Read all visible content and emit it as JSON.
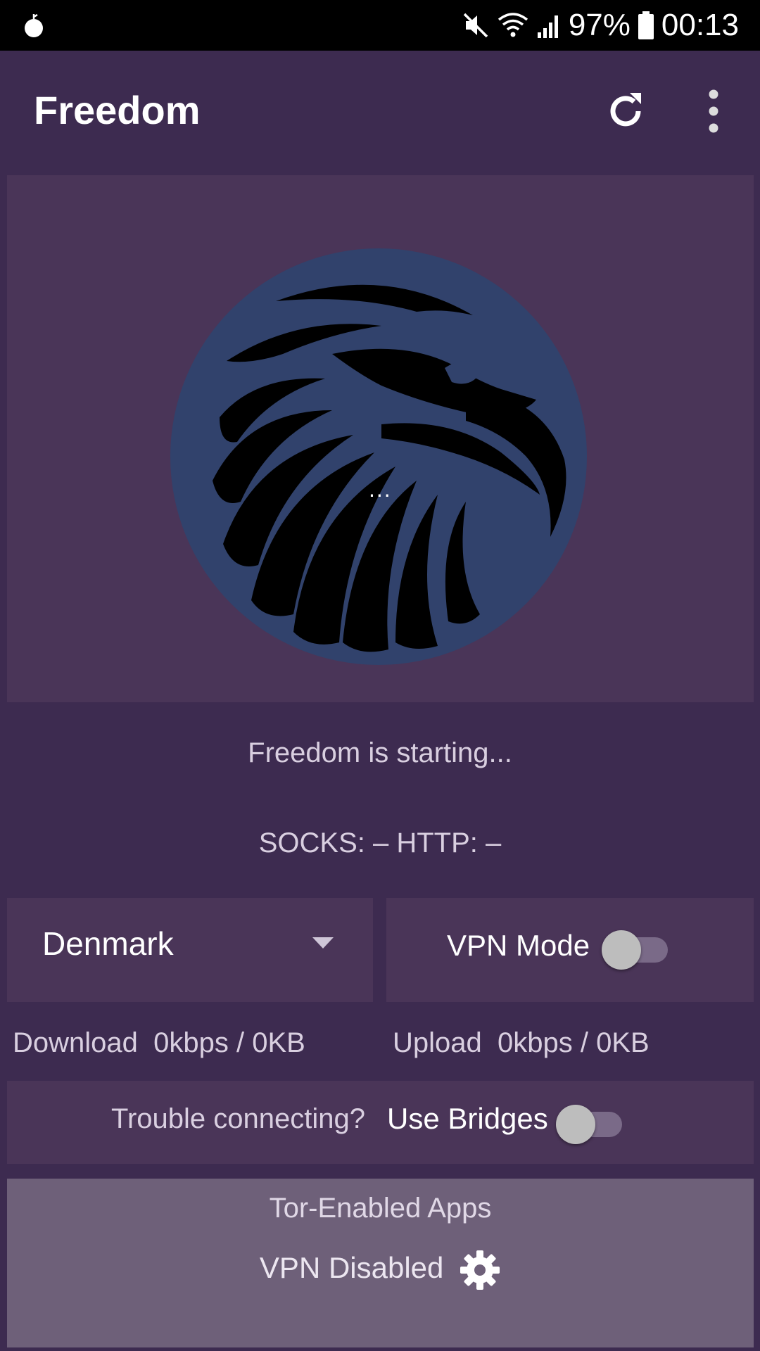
{
  "status_bar": {
    "battery": "97%",
    "time": "00:13",
    "icons": [
      "onion-icon",
      "mute-icon",
      "wifi-icon",
      "signal-icon",
      "battery-icon"
    ]
  },
  "app_bar": {
    "title": "Freedom",
    "icons": [
      "refresh-icon",
      "more-vert-icon"
    ]
  },
  "hero": {
    "logo": "eagle-logo",
    "loading": "..."
  },
  "status": {
    "message": "Freedom is starting...",
    "ports": "SOCKS: – HTTP: –"
  },
  "controls": {
    "country": "Denmark",
    "vpn_mode_label": "VPN Mode",
    "vpn_mode_on": false
  },
  "stats": {
    "download": "Download  0kbps / 0KB",
    "upload": "Upload  0kbps / 0KB"
  },
  "bridges": {
    "question": "Trouble connecting?",
    "label": "Use Bridges",
    "enabled": false
  },
  "apps": {
    "title": "Tor-Enabled Apps",
    "vpn_status": "VPN Disabled",
    "icon": "gear-icon"
  },
  "colors": {
    "background": "#3d2b50",
    "card": "#4a3558",
    "logo_circle": "#31426c",
    "apps_card": "#6e6079"
  }
}
